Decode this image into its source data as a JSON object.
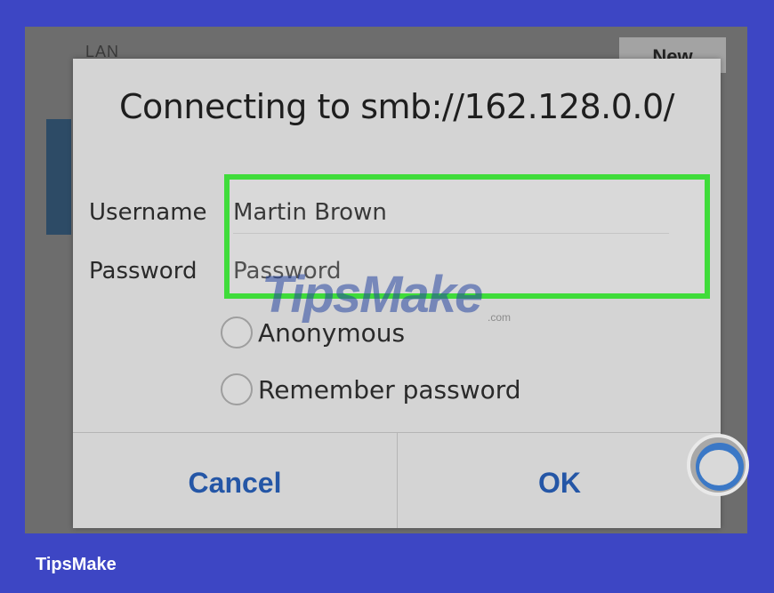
{
  "background": {
    "lan_label": "LAN",
    "new_button": "New"
  },
  "dialog": {
    "title": "Connecting to smb://162.128.0.0/",
    "username_label": "Username",
    "username_value": "Martin Brown",
    "password_label": "Password",
    "password_placeholder": "Password",
    "options": [
      {
        "label": "Anonymous",
        "checked": false
      },
      {
        "label": "Remember password",
        "checked": false
      }
    ],
    "cancel_label": "Cancel",
    "ok_label": "OK"
  },
  "watermark": {
    "text": "TipsMake",
    "suffix": ".com"
  },
  "footer": {
    "brand": "TipsMake"
  },
  "colors": {
    "frame": "#3d46c4",
    "highlight": "#3fdc3a",
    "button_text": "#2456a6"
  }
}
